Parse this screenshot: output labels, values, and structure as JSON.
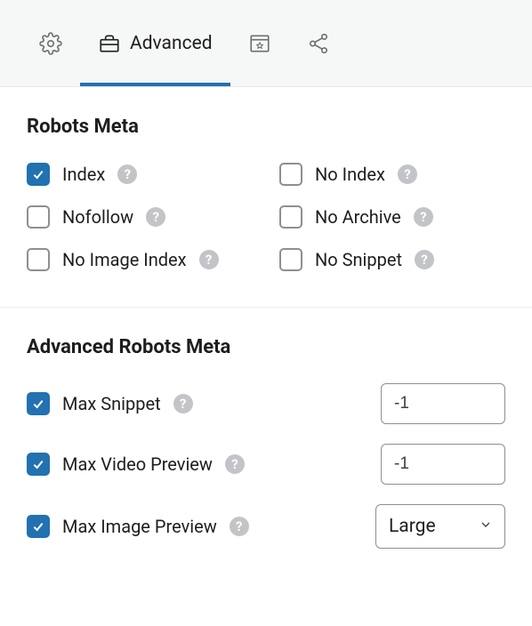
{
  "tabs": {
    "active_label": "Advanced"
  },
  "robots_meta": {
    "title": "Robots Meta",
    "items": [
      {
        "label": "Index",
        "checked": true
      },
      {
        "label": "No Index",
        "checked": false
      },
      {
        "label": "Nofollow",
        "checked": false
      },
      {
        "label": "No Archive",
        "checked": false
      },
      {
        "label": "No Image Index",
        "checked": false
      },
      {
        "label": "No Snippet",
        "checked": false
      }
    ]
  },
  "advanced_robots_meta": {
    "title": "Advanced Robots Meta",
    "max_snippet": {
      "label": "Max Snippet",
      "checked": true,
      "value": "-1"
    },
    "max_video_preview": {
      "label": "Max Video Preview",
      "checked": true,
      "value": "-1"
    },
    "max_image_preview": {
      "label": "Max Image Preview",
      "checked": true,
      "value": "Large"
    }
  }
}
